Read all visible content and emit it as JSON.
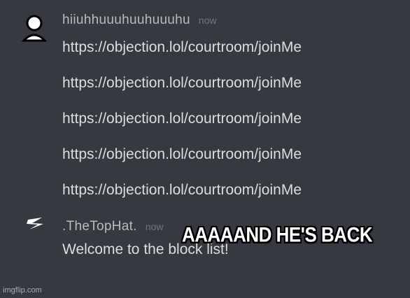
{
  "messages": [
    {
      "username": "hiiuhhuuuhuuhuuuhu",
      "timestamp": "now",
      "avatar_icon": "user-silhouette-icon",
      "lines": [
        "https://objection.lol/courtroom/joinMe",
        "https://objection.lol/courtroom/joinMe",
        "https://objection.lol/courtroom/joinMe",
        "https://objection.lol/courtroom/joinMe",
        "https://objection.lol/courtroom/joinMe"
      ]
    },
    {
      "username": ".TheTopHat.",
      "timestamp": "now",
      "avatar_icon": "lightning-bolt-icon",
      "lines": [
        "Welcome to the block list!"
      ]
    }
  ],
  "overlay_caption": "AAAAAND HE'S BACK",
  "watermark": "imgflip.com"
}
